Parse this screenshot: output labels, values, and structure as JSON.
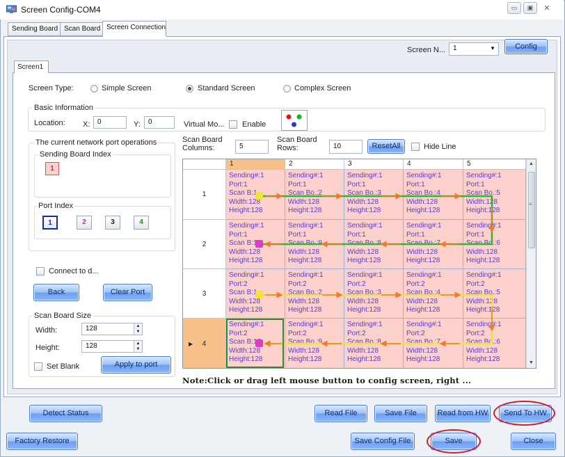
{
  "window": {
    "title": "Screen Config-COM4",
    "minimize": "▭",
    "maximize": "▣",
    "close": "✕"
  },
  "tabs": [
    {
      "label": "Sending Board"
    },
    {
      "label": "Scan Board"
    },
    {
      "label": "Screen Connection"
    }
  ],
  "screen_selector": {
    "label": "Screen N...",
    "value": "1",
    "config_label": "Config"
  },
  "subtab": {
    "label": "Screen1"
  },
  "screen_type": {
    "label": "Screen Type:",
    "options": [
      "Simple Screen",
      "Standard Screen",
      "Complex Screen"
    ],
    "selected": "Standard Screen"
  },
  "basic_info": {
    "title": "Basic Information",
    "location_label": "Location:",
    "x_label": "X:",
    "x_value": "0",
    "y_label": "Y:",
    "y_value": "0",
    "virtual_label": "Virtual Mo...",
    "enable_label": "Enable"
  },
  "scan_board_dims": {
    "columns_label": "Scan Board Columns:",
    "columns_value": "5",
    "rows_label": "Scan Board Rows:",
    "rows_value": "10",
    "reset_label": "ResetAll",
    "hide_line_label": "Hide Line"
  },
  "network_ops": {
    "title": "The current network port operations",
    "sending_index_title": "Sending Board Index",
    "sending_index_value": "1",
    "port_index_title": "Port Index",
    "ports": [
      "1",
      "2",
      "3",
      "4"
    ],
    "port_colors": [
      "#1a2a9a",
      "#cc22cc",
      "#222222",
      "#1f8a1f"
    ]
  },
  "connect": {
    "label": "Connect to d...",
    "back_label": "Back",
    "clear_label": "Clear Port"
  },
  "scan_board_size": {
    "title": "Scan Board Size",
    "width_label": "Width:",
    "width_value": "128",
    "height_label": "Height:",
    "height_value": "128",
    "set_blank_label": "Set Blank",
    "apply_label": "Apply to port"
  },
  "grid": {
    "columns": [
      "1",
      "2",
      "3",
      "4",
      "5"
    ],
    "rows": [
      {
        "label": "1",
        "cells": [
          [
            "Sending#:1",
            "Port:1",
            "Scan B:1",
            "Width:128",
            "Height:128"
          ],
          [
            "Sending#:1",
            "Port:1",
            "Scan Bo.:2",
            "Width:128",
            "Height:128"
          ],
          [
            "Sending#:1",
            "Port:1",
            "Scan Bo.:3",
            "Width:128",
            "Height:128"
          ],
          [
            "Sending#:1",
            "Port:1",
            "Scan Bo.:4",
            "Width:128",
            "Height:128"
          ],
          [
            "Sending#:1",
            "Port:1",
            "Scan Bo.:5",
            "Width:128",
            "Height:128"
          ]
        ]
      },
      {
        "label": "2",
        "cells": [
          [
            "Sending#:1",
            "Port:1",
            "Scan B:10",
            "Width:128",
            "Height:128"
          ],
          [
            "Sending#:1",
            "Port:1",
            "Scan Bo.:9",
            "Width:128",
            "Height:128"
          ],
          [
            "Sending#:1",
            "Port:1",
            "Scan Bo.:8",
            "Width:128",
            "Height:128"
          ],
          [
            "Sending#:1",
            "Port:1",
            "Scan Bo.:7",
            "Width:128",
            "Height:128"
          ],
          [
            "Sending#:1",
            "Port:1",
            "Scan Bo.:6",
            "Width:128",
            "Height:128"
          ]
        ]
      },
      {
        "label": "3",
        "cells": [
          [
            "Sending#:1",
            "Port:2",
            "Scan B:1",
            "Width:128",
            "Height:128"
          ],
          [
            "Sending#:1",
            "Port:2",
            "Scan Bo.:2",
            "Width:128",
            "Height:128"
          ],
          [
            "Sending#:1",
            "Port:2",
            "Scan Bo.:3",
            "Width:128",
            "Height:128"
          ],
          [
            "Sending#:1",
            "Port:2",
            "Scan Bo.:4",
            "Width:128",
            "Height:128"
          ],
          [
            "Sending#:1",
            "Port:2",
            "Scan Bo.:5",
            "Width:128",
            "Height:128"
          ]
        ]
      },
      {
        "label": "4",
        "cells": [
          [
            "Sending#:1",
            "Port:2",
            "Scan B:10",
            "Width:128",
            "Height:128"
          ],
          [
            "Sending#:1",
            "Port:2",
            "Scan Bo.:9",
            "Width:128",
            "Height:128"
          ],
          [
            "Sending#:1",
            "Port:2",
            "Scan Bo.:8",
            "Width:128",
            "Height:128"
          ],
          [
            "Sending#:1",
            "Port:2",
            "Scan Bo.:7",
            "Width:128",
            "Height:128"
          ],
          [
            "Sending#:1",
            "Port:2",
            "Scan Bo.:6",
            "Width:128",
            "Height:128"
          ]
        ]
      }
    ],
    "selected_row": "4",
    "selected_column": "1"
  },
  "note": "Note:Click or drag left mouse button to config screen, right ...",
  "buttons": {
    "detect_status": "Detect Status",
    "read_file": "Read File",
    "save_file": "Save File",
    "read_from_hw": "Read from HW",
    "send_to_hw": "Send To HW",
    "factory_restore": "Factory Restore",
    "save_config_file": "Save Config File",
    "save": "Save",
    "close": "Close"
  },
  "colors": {
    "cell_bg": "#fcd1cc",
    "selected_header": "#f7c28a",
    "port1_line": "#2fb52f",
    "port2_line": "#f3e23a",
    "arrow": "#f07a2a",
    "highlight_ellipse": "#cf1b2a"
  }
}
